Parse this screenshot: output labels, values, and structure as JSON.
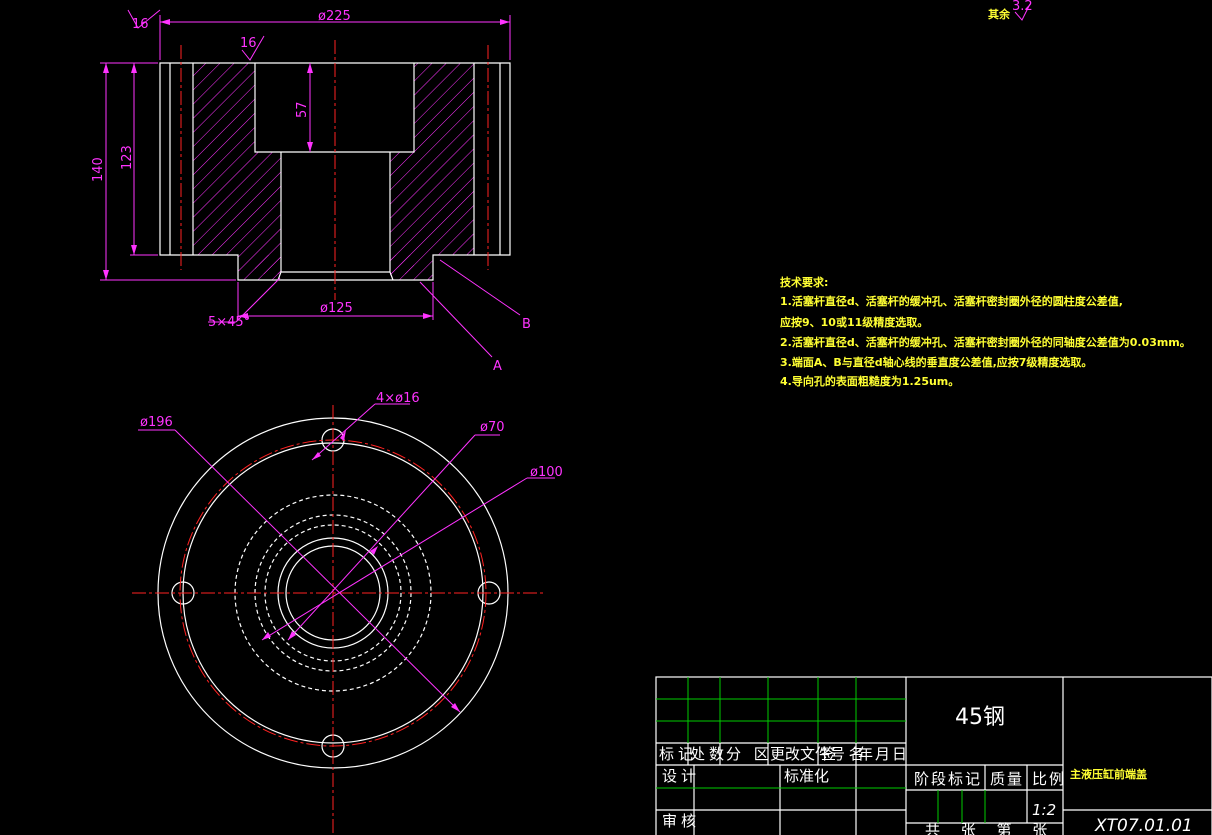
{
  "drawing": {
    "surface_finish_top": "16",
    "surface_finish_bore": "16",
    "finish_other_label": "其余",
    "finish_other_value": "3.2",
    "dims": {
      "top_diameter": "ø225",
      "height_total": "140",
      "height_flange": "123",
      "bore_depth": "57",
      "bottom_diameter": "ø125",
      "chamfer": "5×45°",
      "label_b": "B",
      "label_a": "A",
      "pcd": "ø196",
      "holes": "4×ø16",
      "inner_d1": "ø70",
      "inner_d2": "ø100"
    },
    "tech_requirements": {
      "heading": "技术要求:",
      "lines": [
        "1.活塞杆直径d、活塞杆的缓冲孔、活塞杆密封圈外径的圆柱度公差值,",
        "   应按9、10或11级精度选取。",
        "2.活塞杆直径d、活塞杆的缓冲孔、活塞杆密封圈外径的同轴度公差值为0.03mm。",
        "3.端面A、B与直径d轴心线的垂直度公差值,应按7级精度选取。",
        "4.导向孔的表面粗糙度为1.25um。"
      ]
    }
  },
  "title_block": {
    "material": "45钢",
    "part_name": "主液压缸前端盖",
    "drawing_no": "XT07.01.01",
    "scale": "1:2",
    "headers": [
      "标记",
      "处数",
      "分 区",
      "更改文件号",
      "签 名",
      "年月日"
    ],
    "design": "设计",
    "standardize": "标准化",
    "review": "审核",
    "stage_mark": "阶段标记",
    "weight": "质量",
    "scale_label": "比例",
    "sheets": "共 张 第 张"
  },
  "colors": {
    "background": "#000000",
    "outline": "#ffffff",
    "dimension": "#ff33ff",
    "centerline": "#ff2222",
    "text": "#ffff33",
    "grid": "#00cc00"
  }
}
